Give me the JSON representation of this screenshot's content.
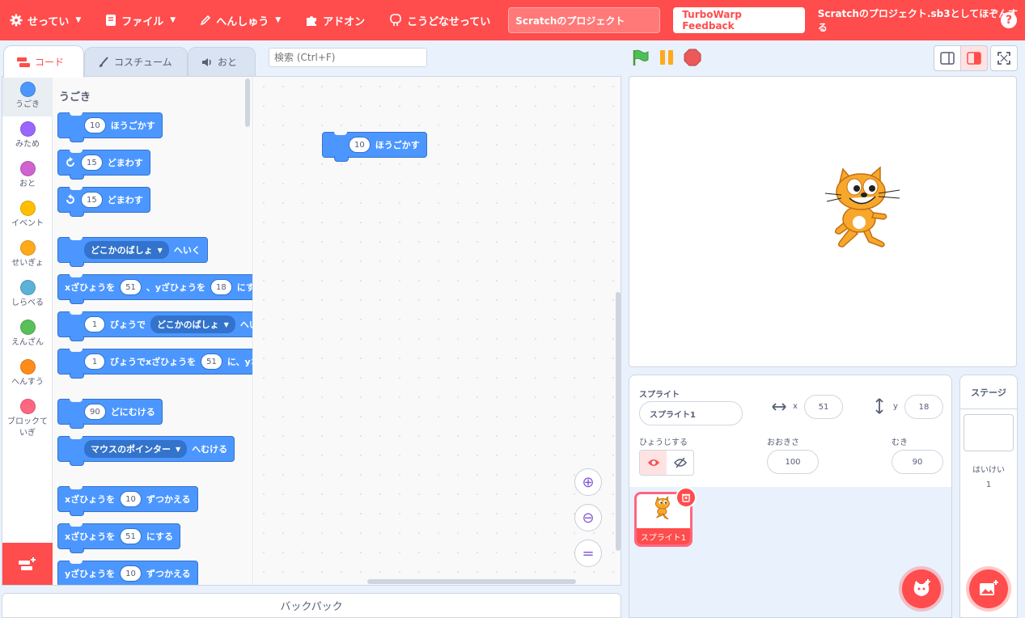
{
  "menu": {
    "settings": "せってい",
    "file": "ファイル",
    "edit": "へんしゅう",
    "addons": "アドオン",
    "advanced": "こうどなせってい",
    "project_title": "Scratchのプロジェクト",
    "feedback": "TurboWarp Feedback",
    "save_as": "Scratchのプロジェクト.sb3としてほぞんする",
    "help": "?"
  },
  "tabs": {
    "code": "コード",
    "costumes": "コスチューム",
    "sounds": "おと"
  },
  "search": {
    "placeholder": "検索 (Ctrl+F)"
  },
  "categories": [
    {
      "label": "うごき",
      "color": "#4c97ff"
    },
    {
      "label": "みため",
      "color": "#9966ff"
    },
    {
      "label": "おと",
      "color": "#cf63cf"
    },
    {
      "label": "イベント",
      "color": "#ffbf00"
    },
    {
      "label": "せいぎょ",
      "color": "#ffab19"
    },
    {
      "label": "しらべる",
      "color": "#5cb1d6"
    },
    {
      "label": "えんざん",
      "color": "#59c059"
    },
    {
      "label": "へんすう",
      "color": "#ff8c1a"
    },
    {
      "label": "ブロックて いぎ",
      "color": "#ff6680"
    }
  ],
  "palette": {
    "heading": "うごき",
    "move": {
      "num": "10",
      "text": "ほうごかす"
    },
    "turn_right": {
      "num": "15",
      "text": "どまわす"
    },
    "turn_left": {
      "num": "15",
      "text": "どまわす"
    },
    "goto": {
      "drop": "どこかのばしょ",
      "text": "へいく"
    },
    "goto_xy": {
      "t1": "xざひょうを",
      "x": "51",
      "t2": "、yざひょうを",
      "y": "18",
      "t3": "にする"
    },
    "glide": {
      "num": "1",
      "t1": "びょうで",
      "drop": "どこかのばしょ",
      "t2": "へい"
    },
    "glide_xy": {
      "num": "1",
      "t1": "びょうでxざひょうを",
      "x": "51",
      "t2": "に、yざ"
    },
    "point_dir": {
      "num": "90",
      "text": "どにむける"
    },
    "point_towards": {
      "drop": "マウスのポインター",
      "text": "へむける"
    },
    "change_x": {
      "t1": "xざひょうを",
      "num": "10",
      "t2": "ずつかえる"
    },
    "set_x": {
      "t1": "xざひょうを",
      "num": "51",
      "t2": "にする"
    },
    "change_y": {
      "t1": "yざひょうを",
      "num": "10",
      "t2": "ずつかえる"
    }
  },
  "script": {
    "num": "10",
    "text": "ほうごかす"
  },
  "backpack": "バックパック",
  "sprite": {
    "label": "スプライト",
    "name": "スプライト1",
    "x_label": "x",
    "x": "51",
    "y_label": "y",
    "y": "18",
    "show_label": "ひょうじする",
    "size_label": "おおきさ",
    "size": "100",
    "direction_label": "むき",
    "direction": "90",
    "tile_name": "スプライト1"
  },
  "stage_pane": {
    "title": "ステージ",
    "backdrops_label": "はいけい",
    "backdrops": "1"
  },
  "colors": {
    "accent": "#ff4c4c",
    "motion": "#4c97ff"
  }
}
